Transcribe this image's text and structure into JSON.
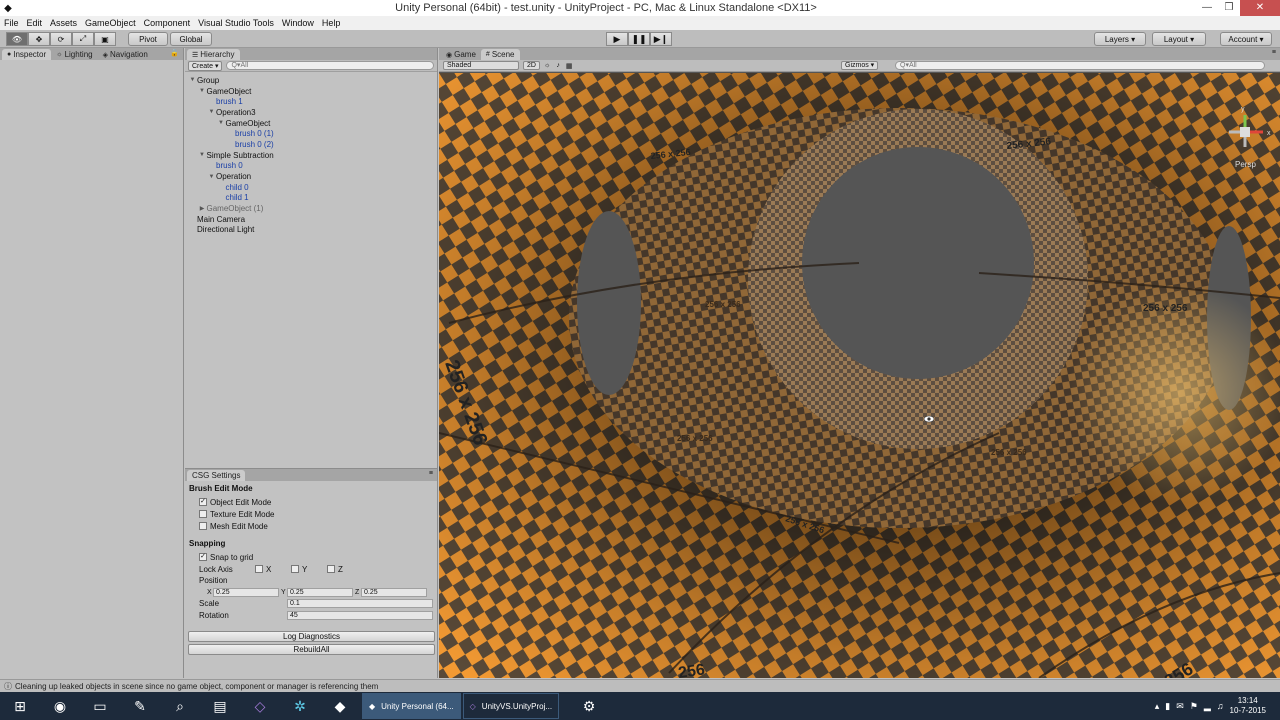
{
  "window": {
    "title": "Unity Personal (64bit) - test.unity - UnityProject - PC, Mac & Linux Standalone <DX11>",
    "minimize": "—",
    "maximize": "❒",
    "close": "✕"
  },
  "menu": [
    "File",
    "Edit",
    "Assets",
    "GameObject",
    "Component",
    "Visual Studio Tools",
    "Window",
    "Help"
  ],
  "toolbar": {
    "pivot": "Pivot",
    "global": "Global",
    "layers": "Layers",
    "layout": "Layout",
    "account": "Account"
  },
  "tabs": {
    "inspector": "Inspector",
    "lighting": "Lighting",
    "navigation": "Navigation",
    "hierarchy": "Hierarchy",
    "game": "Game",
    "scene": "Scene",
    "csg": "CSG Settings"
  },
  "hierarchy": {
    "create": "Create",
    "search_placeholder": "Q▾All",
    "items": [
      {
        "label": "Group",
        "arrow": "▼",
        "style": "normal",
        "depth": 0
      },
      {
        "label": "GameObject",
        "arrow": "▼",
        "style": "normal",
        "depth": 1
      },
      {
        "label": "brush 1",
        "arrow": "",
        "style": "prefab",
        "depth": 2
      },
      {
        "label": "Operation3",
        "arrow": "▼",
        "style": "normal",
        "depth": 2
      },
      {
        "label": "GameObject",
        "arrow": "▼",
        "style": "normal",
        "depth": 3
      },
      {
        "label": "brush 0 (1)",
        "arrow": "",
        "style": "prefab",
        "depth": 4
      },
      {
        "label": "brush 0 (2)",
        "arrow": "",
        "style": "prefab",
        "depth": 4
      },
      {
        "label": "Simple Subtraction",
        "arrow": "▼",
        "style": "normal",
        "depth": 1
      },
      {
        "label": "brush 0",
        "arrow": "",
        "style": "prefab",
        "depth": 2
      },
      {
        "label": "Operation",
        "arrow": "▼",
        "style": "normal",
        "depth": 2
      },
      {
        "label": "child 0",
        "arrow": "",
        "style": "prefab",
        "depth": 3
      },
      {
        "label": "child 1",
        "arrow": "",
        "style": "prefab",
        "depth": 3
      },
      {
        "label": "GameObject (1)",
        "arrow": "▶",
        "style": "inactive",
        "depth": 1
      },
      {
        "label": "Main Camera",
        "arrow": "",
        "style": "normal",
        "depth": 0
      },
      {
        "label": "Directional Light",
        "arrow": "",
        "style": "normal",
        "depth": 0
      }
    ]
  },
  "csg": {
    "brush_edit_mode": "Brush Edit Mode",
    "object_edit": "Object Edit Mode",
    "texture_edit": "Texture Edit Mode",
    "mesh_edit": "Mesh Edit Mode",
    "snapping": "Snapping",
    "snap_to_grid": "Snap to grid",
    "lock_axis": "Lock Axis",
    "ax_x": "X",
    "ax_y": "Y",
    "ax_z": "Z",
    "position": "Position",
    "pos_x": "0.25",
    "pos_y": "0.25",
    "pos_z": "0.25",
    "scale": "Scale",
    "scale_val": "0.1",
    "rotation": "Rotation",
    "rotation_val": "45",
    "log_diagnostics": "Log Diagnostics",
    "rebuild_all": "RebuildAll"
  },
  "scene": {
    "shaded": "Shaded",
    "mode_2d": "2D",
    "gizmos": "Gizmos",
    "search_placeholder": "Q▾All",
    "persp": "Persp",
    "gizmo_y": "y",
    "gizmo_x": "x",
    "tex_labels": [
      "256 x 256",
      "256 x 256",
      "256 x 256",
      "256 x 256",
      "256 x 256",
      "256 x 256",
      "256 x 256",
      "256 x 256",
      "256",
      "256"
    ]
  },
  "status": "Cleaning up leaked objects in scene since no game object, component or manager is referencing them",
  "taskbar": {
    "app1": "Unity Personal (64...",
    "app2": "UnityVS.UnityProj...",
    "time": "13:14",
    "date": "10-7-2015"
  },
  "colors": {
    "checker_orange": "#f39a33",
    "checker_dark": "#5a4a38",
    "void": "#555555"
  }
}
